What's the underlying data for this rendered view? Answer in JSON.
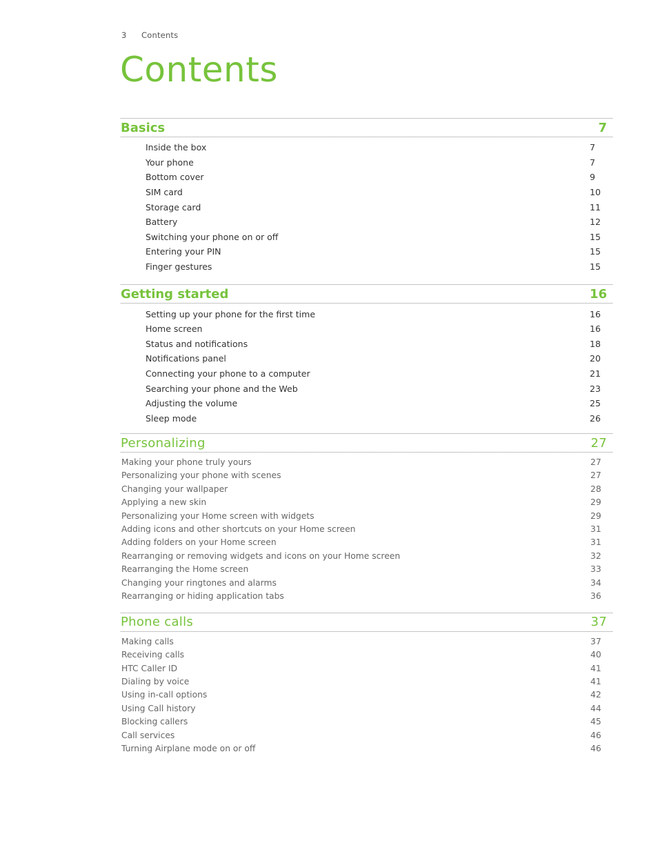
{
  "header": {
    "page_number": "3",
    "running_title": "Contents"
  },
  "title": "Contents",
  "colors": {
    "accent_green": "#77c33c",
    "text_dark": "#333333",
    "text_light": "#666666",
    "rule": "#8a8a8a"
  },
  "sections": [
    {
      "title": "Basics",
      "page": "7",
      "entries": [
        {
          "label": "Inside the box",
          "page": "7"
        },
        {
          "label": "Your phone",
          "page": "7"
        },
        {
          "label": "Bottom cover",
          "page": "9"
        },
        {
          "label": "SIM card",
          "page": "10"
        },
        {
          "label": "Storage card",
          "page": "11"
        },
        {
          "label": "Battery",
          "page": "12"
        },
        {
          "label": "Switching your phone on or off",
          "page": "15"
        },
        {
          "label": "Entering your PIN",
          "page": "15"
        },
        {
          "label": "Finger gestures",
          "page": "15"
        }
      ]
    },
    {
      "title": "Getting started",
      "page": "16",
      "entries": [
        {
          "label": "Setting up your phone for the first time",
          "page": "16"
        },
        {
          "label": "Home screen",
          "page": "16"
        },
        {
          "label": "Status and notifications",
          "page": "18"
        },
        {
          "label": "Notifications panel",
          "page": "20"
        },
        {
          "label": "Connecting your phone to a computer",
          "page": "21"
        },
        {
          "label": "Searching your phone and the Web",
          "page": "23"
        },
        {
          "label": "Adjusting the volume",
          "page": "25"
        },
        {
          "label": "Sleep mode",
          "page": "26"
        }
      ]
    },
    {
      "title": "Personalizing",
      "page": "27",
      "entries": [
        {
          "label": "Making your phone truly yours",
          "page": "27"
        },
        {
          "label": "Personalizing your phone with scenes",
          "page": "27"
        },
        {
          "label": "Changing your wallpaper",
          "page": "28"
        },
        {
          "label": "Applying a new skin",
          "page": "29"
        },
        {
          "label": "Personalizing your Home screen with widgets",
          "page": "29"
        },
        {
          "label": "Adding icons and other shortcuts on your Home screen",
          "page": "31"
        },
        {
          "label": "Adding folders on your Home screen",
          "page": "31"
        },
        {
          "label": "Rearranging or removing widgets and icons on your Home screen",
          "page": "32"
        },
        {
          "label": "Rearranging the Home screen",
          "page": "33"
        },
        {
          "label": "Changing your ringtones and alarms",
          "page": "34"
        },
        {
          "label": "Rearranging or hiding application tabs",
          "page": "36"
        }
      ]
    },
    {
      "title": "Phone calls",
      "page": "37",
      "entries": [
        {
          "label": "Making calls",
          "page": "37"
        },
        {
          "label": "Receiving calls",
          "page": "40"
        },
        {
          "label": "HTC Caller ID",
          "page": "41"
        },
        {
          "label": "Dialing by voice",
          "page": "41"
        },
        {
          "label": "Using in-call options",
          "page": "42"
        },
        {
          "label": "Using Call history",
          "page": "44"
        },
        {
          "label": "Blocking callers",
          "page": "45"
        },
        {
          "label": "Call services",
          "page": "46"
        },
        {
          "label": "Turning Airplane mode on or off",
          "page": "46"
        }
      ]
    }
  ]
}
